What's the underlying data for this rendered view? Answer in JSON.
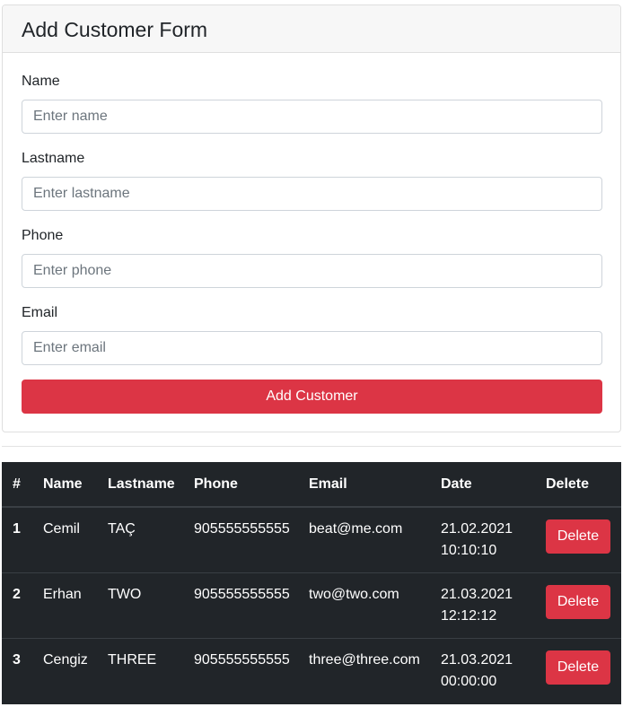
{
  "form": {
    "title": "Add Customer Form",
    "fields": [
      {
        "label": "Name",
        "placeholder": "Enter name",
        "value": ""
      },
      {
        "label": "Lastname",
        "placeholder": "Enter lastname",
        "value": ""
      },
      {
        "label": "Phone",
        "placeholder": "Enter phone",
        "value": ""
      },
      {
        "label": "Email",
        "placeholder": "Enter email",
        "value": ""
      }
    ],
    "submit_label": "Add Customer"
  },
  "table": {
    "headers": [
      "#",
      "Name",
      "Lastname",
      "Phone",
      "Email",
      "Date",
      "Delete"
    ],
    "rows": [
      {
        "id": "1",
        "name": "Cemil",
        "lastname": "TAÇ",
        "phone": "905555555555",
        "email": "beat@me.com",
        "date": "21.02.2021\n10:10:10",
        "delete_label": "Delete"
      },
      {
        "id": "2",
        "name": "Erhan",
        "lastname": "TWO",
        "phone": "905555555555",
        "email": "two@two.com",
        "date": "21.03.2021\n12:12:12",
        "delete_label": "Delete"
      },
      {
        "id": "3",
        "name": "Cengiz",
        "lastname": "THREE",
        "phone": "905555555555",
        "email": "three@three.com",
        "date": "21.03.2021\n00:00:00",
        "delete_label": "Delete"
      }
    ]
  },
  "colors": {
    "accent": "#dc3545",
    "table_bg": "#212529"
  }
}
